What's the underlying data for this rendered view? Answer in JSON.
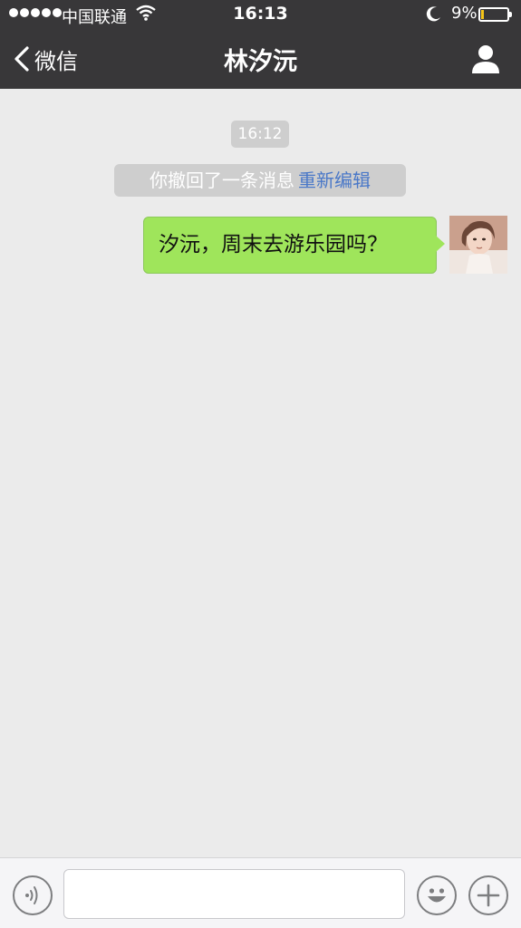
{
  "status_bar": {
    "carrier": "中国联通",
    "time": "16:13",
    "battery_percent": "9%",
    "battery_level": 0.09
  },
  "nav": {
    "back_label": "微信",
    "title": "林汐沅",
    "profile_icon": "person-icon"
  },
  "chat": {
    "timestamp": "16:12",
    "recall_notice": "你撤回了一条消息",
    "recall_edit_link": "重新编辑",
    "messages": [
      {
        "sender": "me",
        "text": "汐沅，周末去游乐园吗？"
      }
    ]
  },
  "input_bar": {
    "text_value": "",
    "voice_icon": "voice-icon",
    "emoji_icon": "emoji-icon",
    "plus_icon": "plus-icon"
  },
  "colors": {
    "nav_bg": "#383739",
    "chat_bg": "#ebebeb",
    "bubble_green": "#9fe55b",
    "link_blue": "#4a78c8"
  }
}
